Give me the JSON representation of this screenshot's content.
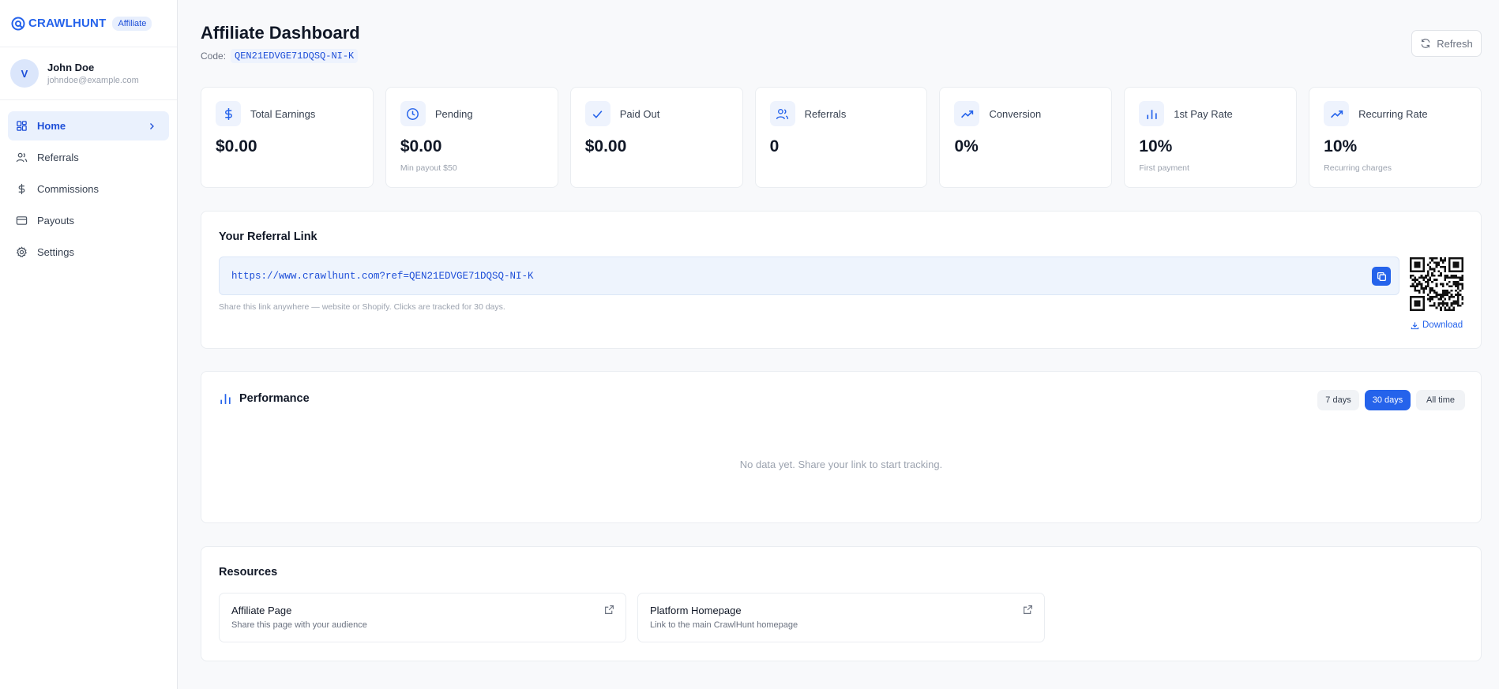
{
  "brand": {
    "name": "CRAWLHUNT",
    "badge": "Affiliate"
  },
  "user": {
    "initial": "V",
    "name": "John Doe",
    "email": "johndoe@example.com"
  },
  "nav": [
    {
      "label": "Home",
      "icon": "grid-icon",
      "active": true
    },
    {
      "label": "Referrals",
      "icon": "users-icon"
    },
    {
      "label": "Commissions",
      "icon": "dollar-icon"
    },
    {
      "label": "Payouts",
      "icon": "card-icon"
    },
    {
      "label": "Settings",
      "icon": "gear-icon"
    }
  ],
  "header": {
    "title": "Affiliate Dashboard",
    "code_label": "Code:",
    "code": "QEN21EDVGE71DQSQ-NI-K",
    "refresh_label": "Refresh"
  },
  "stats": [
    {
      "label": "Total Earnings",
      "value": "$0.00",
      "sub": "",
      "icon": "dollar-icon"
    },
    {
      "label": "Pending",
      "value": "$0.00",
      "sub": "Min payout $50",
      "icon": "clock-icon"
    },
    {
      "label": "Paid Out",
      "value": "$0.00",
      "sub": "",
      "icon": "check-icon"
    },
    {
      "label": "Referrals",
      "value": "0",
      "sub": "",
      "icon": "users-icon"
    },
    {
      "label": "Conversion",
      "value": "0%",
      "sub": "",
      "icon": "trending-up-icon"
    },
    {
      "label": "1st Pay Rate",
      "value": "10%",
      "sub": "First payment",
      "icon": "bar-chart-icon"
    },
    {
      "label": "Recurring Rate",
      "value": "10%",
      "sub": "Recurring charges",
      "icon": "trending-up-icon"
    }
  ],
  "referral": {
    "title": "Your Referral Link",
    "link": "https://www.crawlhunt.com?ref=QEN21EDVGE71DQSQ-NI-K",
    "hint": "Share this link anywhere — website or Shopify. Clicks are tracked for 30 days.",
    "download_label": "Download"
  },
  "performance": {
    "title": "Performance",
    "ranges": [
      "7 days",
      "30 days",
      "All time"
    ],
    "selected_range": "30 days",
    "empty_message": "No data yet. Share your link to start tracking."
  },
  "resources": {
    "title": "Resources",
    "items": [
      {
        "name": "Affiliate Page",
        "desc": "Share this page with your audience"
      },
      {
        "name": "Platform Homepage",
        "desc": "Link to the main CrawlHunt homepage"
      }
    ]
  },
  "colors": {
    "accent": "#2563eb",
    "accent_bg": "#eef3fd",
    "page_bg": "#f8f9fb"
  }
}
